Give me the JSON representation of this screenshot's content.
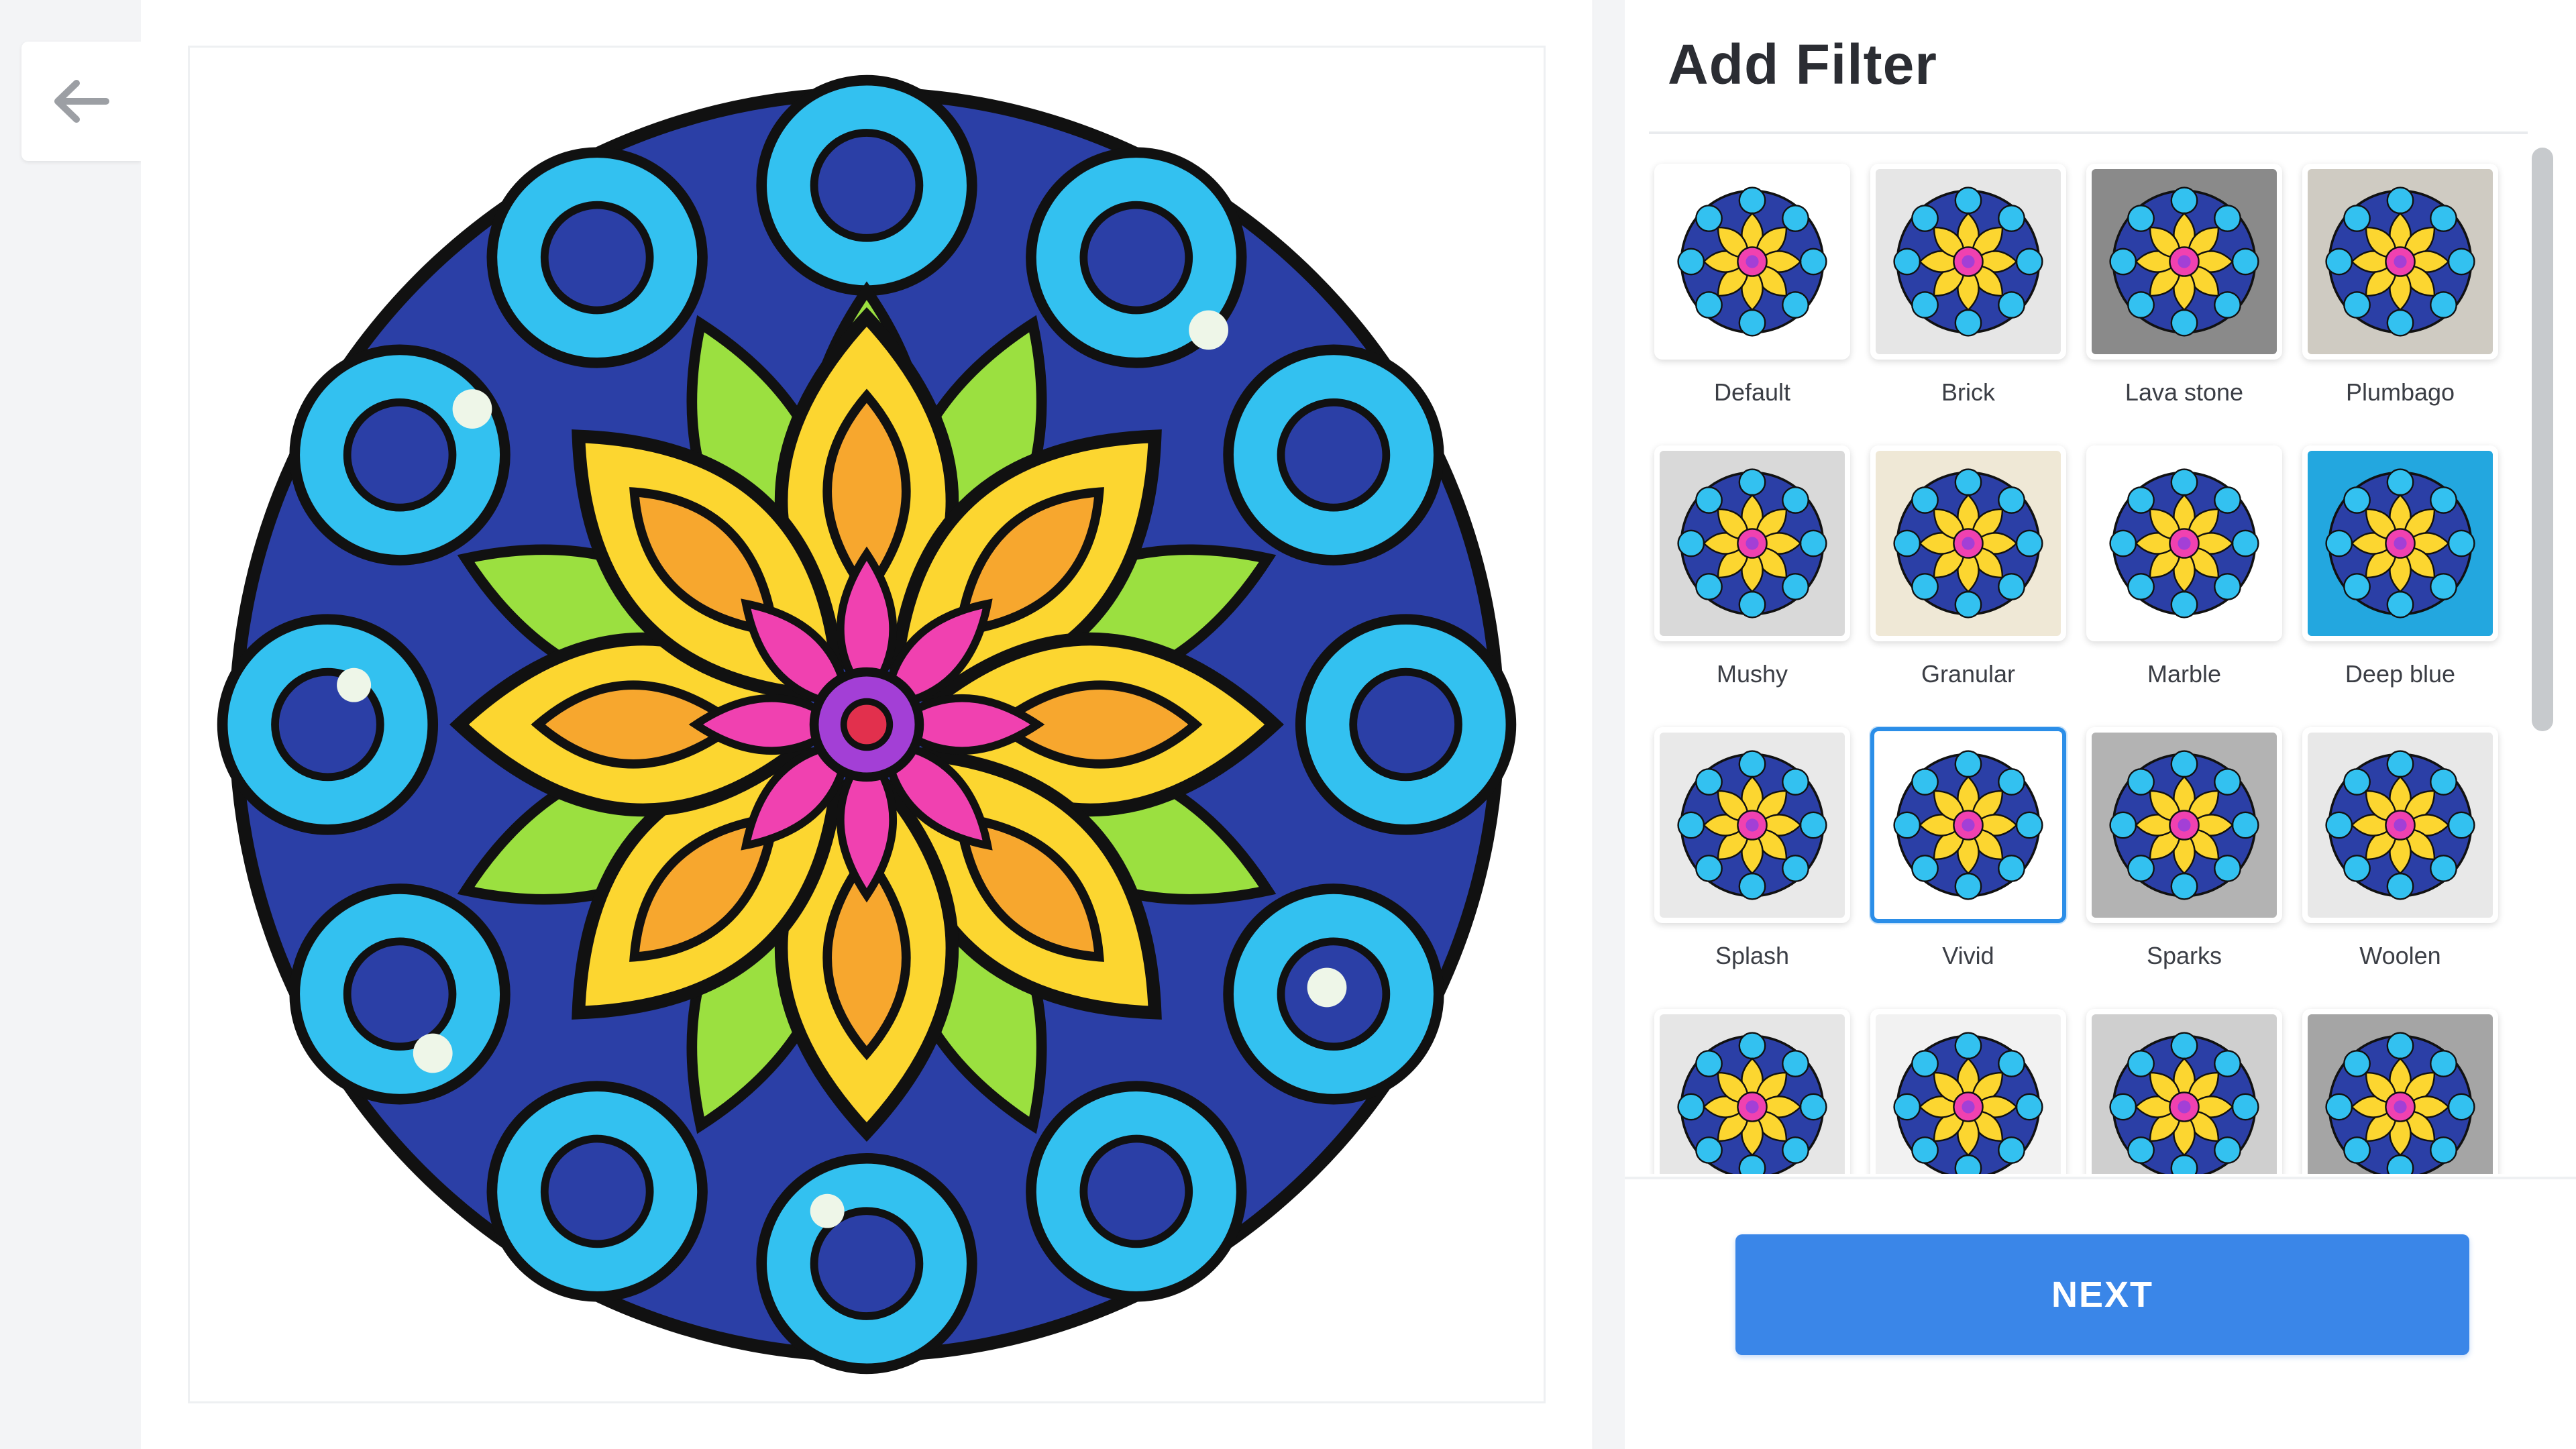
{
  "header": {
    "back_icon": "arrow-left-icon"
  },
  "canvas": {
    "image_label": "mandala artwork"
  },
  "sidebar": {
    "title": "Add Filter",
    "filters": [
      {
        "label": "Default",
        "bg": "#ffffff",
        "selected": false
      },
      {
        "label": "Brick",
        "bg": "#e6e6e6",
        "selected": false
      },
      {
        "label": "Lava stone",
        "bg": "#8a8a8a",
        "selected": false
      },
      {
        "label": "Plumbago",
        "bg": "#cfcbc2",
        "selected": false
      },
      {
        "label": "Mushy",
        "bg": "#d9d9d9",
        "selected": false
      },
      {
        "label": "Granular",
        "bg": "#efe8d6",
        "selected": false
      },
      {
        "label": "Marble",
        "bg": "#ffffff",
        "selected": false
      },
      {
        "label": "Deep blue",
        "bg": "#23a7df",
        "selected": false
      },
      {
        "label": "Splash",
        "bg": "#e9e9e9",
        "selected": false
      },
      {
        "label": "Vivid",
        "bg": "#ffffff",
        "selected": true
      },
      {
        "label": "Sparks",
        "bg": "#b3b3b3",
        "selected": false
      },
      {
        "label": "Woolen",
        "bg": "#e8e8e8",
        "selected": false
      },
      {
        "label": "",
        "bg": "#e6e6e6",
        "selected": false
      },
      {
        "label": "",
        "bg": "#f2f2f2",
        "selected": false
      },
      {
        "label": "",
        "bg": "#cfcfcf",
        "selected": false
      },
      {
        "label": "",
        "bg": "#a5a5a5",
        "selected": false
      }
    ]
  },
  "next_button": {
    "label": "NEXT"
  },
  "colors": {
    "accent": "#3a86e8",
    "selected_border": "#2b8ee8"
  }
}
